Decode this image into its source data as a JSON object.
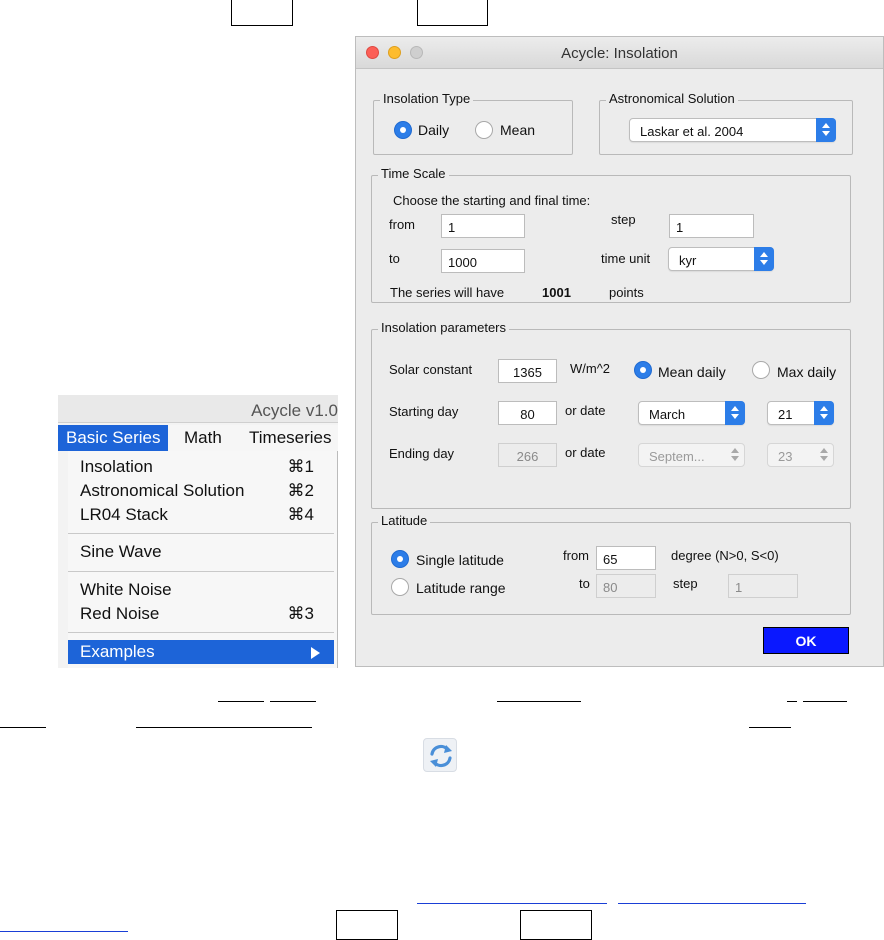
{
  "main_window": {
    "title": "Acycle v1.0",
    "menubar": [
      "Basic Series",
      "Math",
      "Timeseries"
    ],
    "menu": {
      "items": [
        {
          "label": "Insolation",
          "shortcut": "⌘1"
        },
        {
          "label": "Astronomical Solution",
          "shortcut": "⌘2"
        },
        {
          "label": "LR04 Stack",
          "shortcut": "⌘4"
        },
        {
          "label": "Sine Wave",
          "shortcut": ""
        },
        {
          "label": "White Noise",
          "shortcut": ""
        },
        {
          "label": "Red Noise",
          "shortcut": "⌘3"
        },
        {
          "label": "Examples",
          "shortcut": ""
        }
      ]
    }
  },
  "dialog": {
    "title": "Acycle: Insolation",
    "insolation_type": {
      "group_label": "Insolation Type",
      "options": [
        "Daily",
        "Mean"
      ],
      "selected": "Daily"
    },
    "astronomical_solution": {
      "group_label": "Astronomical Solution",
      "selected": "Laskar et al. 2004"
    },
    "time_scale": {
      "group_label": "Time Scale",
      "prompt": "Choose the starting and final time:",
      "from_label": "from",
      "from_value": "1",
      "to_label": "to",
      "to_value": "1000",
      "step_label": "step",
      "step_value": "1",
      "time_unit_label": "time unit",
      "time_unit": "kyr",
      "summary_prefix": "The series will have",
      "points": "1001",
      "summary_suffix": "points"
    },
    "insolation_parameters": {
      "group_label": "Insolation parameters",
      "solar_constant_label": "Solar constant",
      "solar_constant": "1365",
      "unit": "W/m^2",
      "mode_options": [
        "Mean daily",
        "Max daily"
      ],
      "mode_selected": "Mean daily",
      "starting_day_label": "Starting day",
      "starting_day": "80",
      "or_date_label": "or date",
      "start_month": "March",
      "start_day_of_month": "21",
      "ending_day_label": "Ending day",
      "ending_day": "266",
      "end_month": "Septem...",
      "end_day_of_month": "23"
    },
    "latitude": {
      "group_label": "Latitude",
      "options": [
        "Single latitude",
        "Latitude range"
      ],
      "selected": "Single latitude",
      "from_label": "from",
      "from_value": "65",
      "degree_note": "degree (N>0, S<0)",
      "to_label": "to",
      "to_value": "80",
      "step_label": "step",
      "step_value": "1"
    },
    "ok_label": "OK"
  },
  "icons": {
    "refresh": "refresh-icon"
  },
  "colors": {
    "accent": "#2c7de8",
    "menu_highlight": "#1d64d8",
    "ok_button": "#0a18ff"
  }
}
